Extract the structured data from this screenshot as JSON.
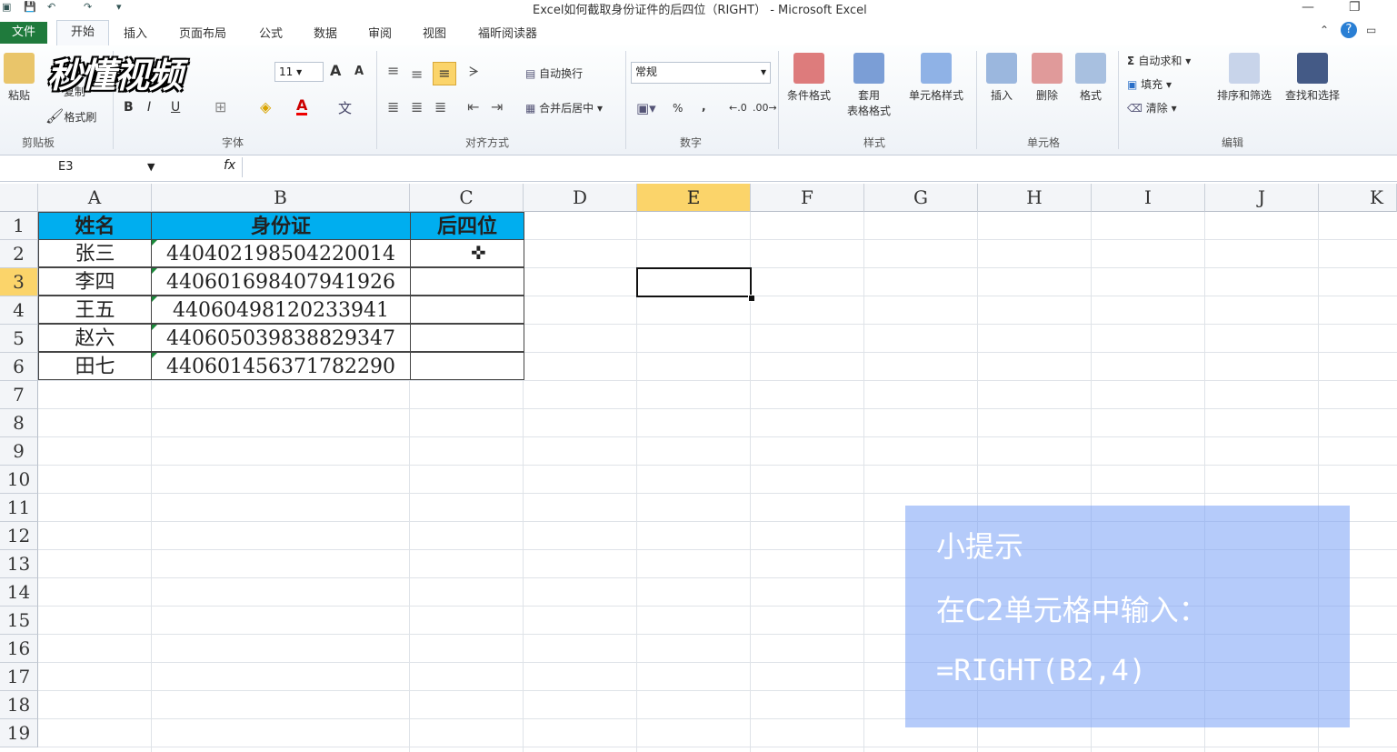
{
  "window": {
    "title": "Excel如何截取身份证件的后四位（RIGHT） - Microsoft Excel"
  },
  "tabs": [
    "文件",
    "开始",
    "插入",
    "页面布局",
    "公式",
    "数据",
    "审阅",
    "视图",
    "福昕阅读器"
  ],
  "ribbon": {
    "clipboard": {
      "paste": "粘贴",
      "copy": "复制",
      "format_painter": "格式刷",
      "label": "剪贴板"
    },
    "font": {
      "size": "11",
      "label": "字体",
      "bold": "B",
      "italic": "I",
      "underline": "U",
      "grow": "A",
      "shrink": "A",
      "color_a": "A"
    },
    "alignment": {
      "wrap": "自动换行",
      "merge": "合并后居中",
      "label": "对齐方式"
    },
    "number": {
      "format": "常规",
      "percent": "%",
      "comma": ",",
      "label": "数字"
    },
    "styles": {
      "conditional": "条件格式",
      "table_l1": "套用",
      "table_l2": "表格格式",
      "cell_styles": "单元格样式",
      "label": "样式"
    },
    "cells": {
      "insert": "插入",
      "delete": "删除",
      "format": "格式",
      "label": "单元格"
    },
    "editing": {
      "autosum": "自动求和",
      "fill": "填充",
      "clear": "清除",
      "sort": "排序和筛选",
      "find": "查找和选择",
      "label": "编辑"
    }
  },
  "logo_text": "秒懂视频",
  "formula_bar": {
    "name_box": "E3",
    "fx": "fx",
    "formula": ""
  },
  "columns": [
    "A",
    "B",
    "C",
    "D",
    "E",
    "F",
    "G",
    "H",
    "I",
    "J",
    "K"
  ],
  "rows": [
    "1",
    "2",
    "3",
    "4",
    "5",
    "6",
    "7",
    "8",
    "9",
    "10",
    "11",
    "12",
    "13",
    "14",
    "15",
    "16",
    "17",
    "18",
    "19"
  ],
  "table": {
    "headers": [
      "姓名",
      "身份证",
      "后四位"
    ],
    "rows": [
      [
        "张三",
        "440402198504220014",
        ""
      ],
      [
        "李四",
        "440601698407941926",
        ""
      ],
      [
        "王五",
        "44060498120233941",
        ""
      ],
      [
        "赵六",
        "440605039838829347",
        ""
      ],
      [
        "田七",
        "440601456371782290",
        ""
      ]
    ]
  },
  "hint": {
    "title": "小提示",
    "line1": "在C2单元格中输入：",
    "line2": "=RIGHT(B2,4)"
  },
  "colors": {
    "header_fill": "#00aeef",
    "selected_header": "#fbd46a",
    "file_tab": "#1f7a3c",
    "hint_panel": "#78a0f5"
  }
}
